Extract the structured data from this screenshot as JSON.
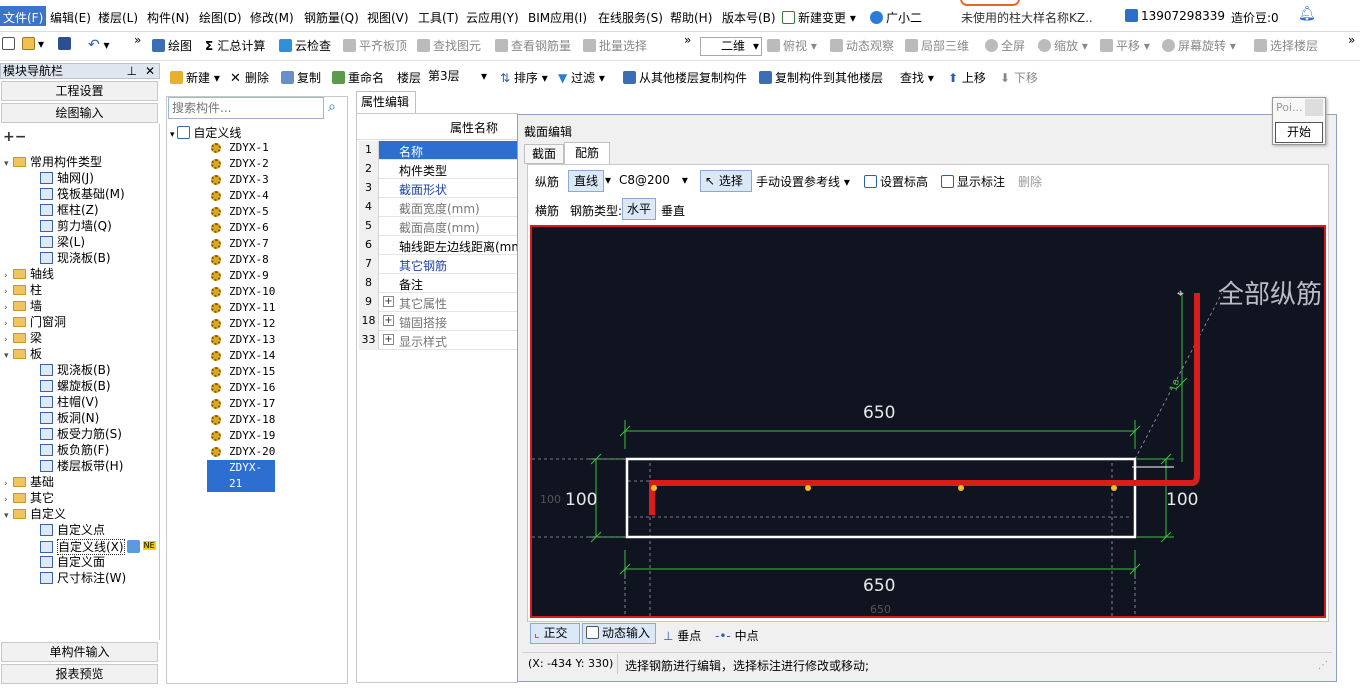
{
  "menu": {
    "items": [
      "文件(F)",
      "编辑(E)",
      "楼层(L)",
      "构件(N)",
      "绘图(D)",
      "修改(M)",
      "钢筋量(Q)",
      "视图(V)",
      "工具(T)",
      "云应用(Y)",
      "BIM应用(I)",
      "在线服务(S)",
      "帮助(H)",
      "版本号(B)"
    ],
    "new_change": "新建变更",
    "assistant": "广小二",
    "notice": "未使用的柱大样名称KZ..",
    "account": "13907298339",
    "beans": "造价豆:0"
  },
  "toolbar1": {
    "draw": "绘图",
    "sum": "汇总计算",
    "cloud_check": "云检查",
    "flat_top": "平齐板顶",
    "find_elem": "查找图元",
    "view_rebar": "查看钢筋量",
    "batch_select": "批量选择",
    "view_mode": "二维",
    "top_view": "俯视",
    "dynamic": "动态观察",
    "local3d": "局部三维",
    "fullscreen": "全屏",
    "zoom": "缩放",
    "pan": "平移",
    "rotate": "屏幕旋转",
    "select_floor": "选择楼层"
  },
  "toolbar2": {
    "new": "新建",
    "delete": "删除",
    "copy": "复制",
    "rename": "重命名",
    "floor_label": "楼层",
    "floor_value": "第3层",
    "sort": "排序",
    "filter": "过滤",
    "copy_from": "从其他楼层复制构件",
    "copy_to": "复制构件到其他楼层",
    "find": "查找",
    "move_up": "上移",
    "move_down": "下移"
  },
  "nav": {
    "title": "模块导航栏",
    "project_settings": "工程设置",
    "drawing_input": "绘图输入",
    "tree": [
      {
        "label": "常用构件类型",
        "level": 0,
        "type": "folder",
        "open": true
      },
      {
        "label": "轴网(J)",
        "level": 1,
        "type": "leaf"
      },
      {
        "label": "筏板基础(M)",
        "level": 1,
        "type": "leaf"
      },
      {
        "label": "框柱(Z)",
        "level": 1,
        "type": "leaf"
      },
      {
        "label": "剪力墙(Q)",
        "level": 1,
        "type": "leaf"
      },
      {
        "label": "梁(L)",
        "level": 1,
        "type": "leaf"
      },
      {
        "label": "现浇板(B)",
        "level": 1,
        "type": "leaf"
      },
      {
        "label": "轴线",
        "level": 0,
        "type": "folder",
        "open": false
      },
      {
        "label": "柱",
        "level": 0,
        "type": "folder",
        "open": false
      },
      {
        "label": "墙",
        "level": 0,
        "type": "folder",
        "open": false
      },
      {
        "label": "门窗洞",
        "level": 0,
        "type": "folder",
        "open": false
      },
      {
        "label": "梁",
        "level": 0,
        "type": "folder",
        "open": false
      },
      {
        "label": "板",
        "level": 0,
        "type": "folder",
        "open": true
      },
      {
        "label": "现浇板(B)",
        "level": 1,
        "type": "leaf"
      },
      {
        "label": "螺旋板(B)",
        "level": 1,
        "type": "leaf"
      },
      {
        "label": "柱帽(V)",
        "level": 1,
        "type": "leaf"
      },
      {
        "label": "板洞(N)",
        "level": 1,
        "type": "leaf"
      },
      {
        "label": "板受力筋(S)",
        "level": 1,
        "type": "leaf"
      },
      {
        "label": "板负筋(F)",
        "level": 1,
        "type": "leaf"
      },
      {
        "label": "楼层板带(H)",
        "level": 1,
        "type": "leaf"
      },
      {
        "label": "基础",
        "level": 0,
        "type": "folder",
        "open": false
      },
      {
        "label": "其它",
        "level": 0,
        "type": "folder",
        "open": false
      },
      {
        "label": "自定义",
        "level": 0,
        "type": "folder",
        "open": true
      },
      {
        "label": "自定义点",
        "level": 1,
        "type": "leaf"
      },
      {
        "label": "自定义线(X)",
        "level": 1,
        "type": "leaf",
        "selected": true
      },
      {
        "label": "自定义面",
        "level": 1,
        "type": "leaf"
      },
      {
        "label": "尺寸标注(W)",
        "level": 1,
        "type": "leaf"
      }
    ],
    "new_badge": "NE",
    "single_input": "单构件输入",
    "report_preview": "报表预览"
  },
  "components": {
    "search_placeholder": "搜索构件...",
    "root": "自定义线",
    "items": [
      "ZDYX-1",
      "ZDYX-2",
      "ZDYX-3",
      "ZDYX-4",
      "ZDYX-5",
      "ZDYX-6",
      "ZDYX-7",
      "ZDYX-8",
      "ZDYX-9",
      "ZDYX-10",
      "ZDYX-11",
      "ZDYX-12",
      "ZDYX-13",
      "ZDYX-14",
      "ZDYX-15",
      "ZDYX-16",
      "ZDYX-17",
      "ZDYX-18",
      "ZDYX-19",
      "ZDYX-20",
      "ZDYX-21"
    ],
    "selected_index": 20
  },
  "props": {
    "tab": "属性编辑",
    "header": "属性名称",
    "rows": [
      {
        "num": "1",
        "label": "名称",
        "style": "selected"
      },
      {
        "num": "2",
        "label": "构件类型",
        "style": "normal"
      },
      {
        "num": "3",
        "label": "截面形状",
        "style": "blue"
      },
      {
        "num": "4",
        "label": "截面宽度(mm)",
        "style": "gray"
      },
      {
        "num": "5",
        "label": "截面高度(mm)",
        "style": "gray"
      },
      {
        "num": "6",
        "label": "轴线距左边线距离(mm)",
        "style": "normal"
      },
      {
        "num": "7",
        "label": "其它钢筋",
        "style": "blue"
      },
      {
        "num": "8",
        "label": "备注",
        "style": "normal"
      },
      {
        "num": "9",
        "label": "其它属性",
        "style": "gray",
        "expand": true
      },
      {
        "num": "18",
        "label": "锚固搭接",
        "style": "gray",
        "expand": true
      },
      {
        "num": "33",
        "label": "显示样式",
        "style": "gray",
        "expand": true
      }
    ]
  },
  "dialog": {
    "title": "截面编辑",
    "tabs": [
      "截面",
      "配筋"
    ],
    "active_tab": "配筋",
    "longitudinal": "纵筋",
    "line_mode": "直线",
    "rebar_spec": "C8@200",
    "select": "选择",
    "manual_ref": "手动设置参考线",
    "set_elev": "设置标高",
    "show_label": "显示标注",
    "delete": "删除",
    "transverse": "横筋",
    "rebar_type": "钢筋类型:",
    "horizontal": "水平",
    "vertical": "垂直",
    "ortho": "正交",
    "dyn_input": "动态输入",
    "perp": "垂点",
    "mid": "中点",
    "coords": "(X: -434 Y: 330)",
    "status": "选择钢筋进行编辑，选择标注进行修改或移动;"
  },
  "drawing": {
    "dim_top": "650",
    "dim_bottom": "650",
    "dim_bottom_small": "650",
    "dim_left": "100",
    "dim_left_small": "100",
    "dim_right": "100",
    "label_la": "1a",
    "rebar_text": "全部纵筋"
  },
  "popup": {
    "title": "Poi...",
    "start": "开始"
  }
}
